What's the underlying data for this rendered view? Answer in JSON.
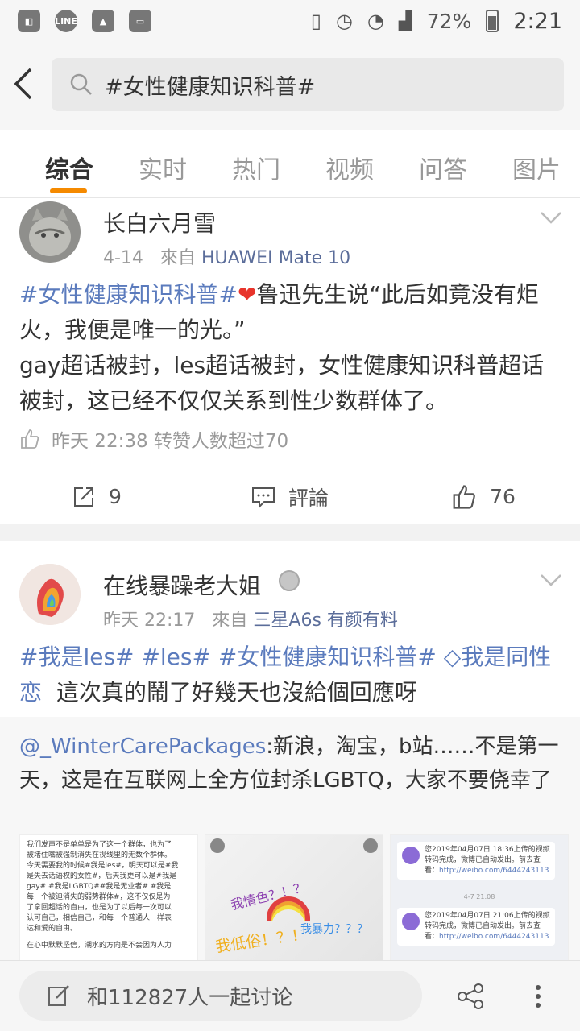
{
  "status_bar": {
    "battery": "72%",
    "time": "2:21",
    "left_icons": [
      "app-icon",
      "line-icon",
      "gallery-icon",
      "bus-icon"
    ],
    "right_icons": [
      "vibrate-icon",
      "alarm-icon",
      "wifi-icon",
      "signal-icon",
      "battery-icon"
    ]
  },
  "search": {
    "query": "#女性健康知识科普#"
  },
  "tabs": [
    "综合",
    "实时",
    "热门",
    "视频",
    "问答",
    "图片"
  ],
  "active_tab": "综合",
  "post1": {
    "username": "长白六月雪",
    "date": "4-14",
    "from_label": "來自",
    "source": "HUAWEI Mate 10",
    "tag": "#女性健康知识科普#",
    "text1": "鲁迅先生说“此后如竟没有炬火，我便是唯一的光。”",
    "text2": "gay超话被封，les超话被封，女性健康知识科普超话被封，这已经不仅仅关系到性少数群体了。",
    "like_info": "昨天 22:38 转赞人数超过70",
    "repost_count": "9",
    "comment_label": "評論",
    "like_count": "76"
  },
  "post2": {
    "username": "在线暴躁老大姐",
    "time": "昨天 22:17",
    "from_label": "來自",
    "source": "三星A6s 有颜有料",
    "tag1": "#我是les#",
    "tag2": "#les#",
    "tag3": "#女性健康知识科普#",
    "tag4": "我是同性恋",
    "text": "這次真的鬧了好幾天也沒給個回應呀",
    "repost_author": "@_WinterCarePackages",
    "repost_text": ":新浪，淘宝，b站……不是第一天，这是在互联网上全方位封杀LGBTQ，大家不要侥幸了",
    "thumb1_lines": [
      "我们发声不是单单是为了这一个群体，也为了",
      "被堵住嘴被强制消失在视线里的无数个群体。",
      "今天需要我的时候#我是les#，明天可以是#我",
      "是失去话语权的女性#，后天我更可以是#我是",
      "gay# #我是LGBTQ##我是无业者# #我是",
      "每一个被迫消失的弱势群体#，这不仅仅是为",
      "了拿回超话的自由，也是为了以后每一次可以",
      "认可自己，相信自己，和每一个普通人一样表",
      "达和爱的自由。",
      "",
      "在心中默默坚信，潮水的方向是不会因为人力"
    ],
    "thumb2_texts": [
      "我情色？！？",
      "我低俗！？！",
      "我暴力？？？"
    ],
    "thumb3_msg1": "您2019年04月07日 18:36上传的视频转码完成，微博已自动发出。前去查看：",
    "thumb3_link1": "http://weibo.com/6444243113",
    "thumb3_date": "4-7 21:08",
    "thumb3_msg2": "您2019年04月07日 21:06上传的视频转码完成，微博已自动发出。前去查看：",
    "thumb3_link2": "http://weibo.com/6444243113"
  },
  "bottom_bar": {
    "discuss_label": "和112827人一起讨论"
  }
}
